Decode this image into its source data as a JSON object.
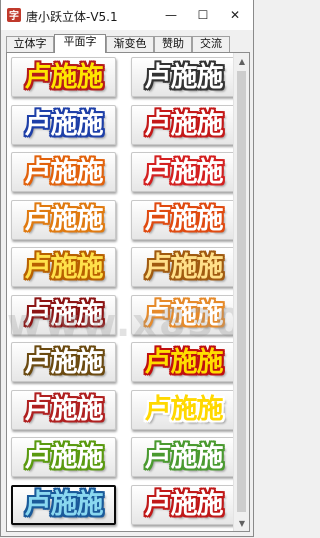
{
  "window": {
    "title": "唐小跃立体-V5.1",
    "minimize": "—",
    "maximize": "☐",
    "close": "✕"
  },
  "tabs": [
    {
      "label": "立体字",
      "active": false
    },
    {
      "label": "平面字",
      "active": true
    },
    {
      "label": "渐变色",
      "active": false
    },
    {
      "label": "赞助",
      "active": false
    },
    {
      "label": "交流",
      "active": false
    }
  ],
  "samples": [
    {
      "text": "卢施施",
      "fill": "#ffe600",
      "stroke": "#b51a1a",
      "selected": false
    },
    {
      "text": "卢施施",
      "fill": "#ffffff",
      "stroke": "#333333",
      "selected": false
    },
    {
      "text": "卢施施",
      "fill": "#ffffff",
      "stroke": "#1e3fa8",
      "selected": false
    },
    {
      "text": "卢施施",
      "fill": "#ffffff",
      "stroke": "#c41818",
      "selected": false
    },
    {
      "text": "卢施施",
      "fill": "#ffffff",
      "stroke": "#e2620c",
      "selected": false
    },
    {
      "text": "卢施施",
      "fill": "#ffffff",
      "stroke": "#d42020",
      "selected": false
    },
    {
      "text": "卢施施",
      "fill": "#ffffff",
      "stroke": "#e07a10",
      "selected": false
    },
    {
      "text": "卢施施",
      "fill": "#ffffff",
      "stroke": "#e04a10",
      "selected": false
    },
    {
      "text": "卢施施",
      "fill": "#ffe14a",
      "stroke": "#b86000",
      "selected": false
    },
    {
      "text": "卢施施",
      "fill": "#ffe08a",
      "stroke": "#a05a10",
      "selected": false
    },
    {
      "text": "卢施施",
      "fill": "#ffffff",
      "stroke": "#8c1414",
      "selected": false
    },
    {
      "text": "卢施施",
      "fill": "#ffffff",
      "stroke": "#e68a2a",
      "selected": false
    },
    {
      "text": "卢施施",
      "fill": "#ffffff",
      "stroke": "#6b4a10",
      "selected": false
    },
    {
      "text": "卢施施",
      "fill": "#ffdd00",
      "stroke": "#c01010",
      "selected": false
    },
    {
      "text": "卢施施",
      "fill": "#ffffff",
      "stroke": "#b02020",
      "selected": false
    },
    {
      "text": "卢施施",
      "fill": "#ffd800",
      "stroke": "#ffffff",
      "selected": false
    },
    {
      "text": "卢施施",
      "fill": "#ffffff",
      "stroke": "#5a9a10",
      "selected": false
    },
    {
      "text": "卢施施",
      "fill": "#ffffff",
      "stroke": "#4a9a30",
      "selected": false
    },
    {
      "text": "卢施施",
      "fill": "#8ad8f0",
      "stroke": "#1a5a9a",
      "selected": true
    },
    {
      "text": "卢施施",
      "fill": "#ffffff",
      "stroke": "#c01818",
      "selected": false
    }
  ],
  "watermark": "www.x8301.com"
}
